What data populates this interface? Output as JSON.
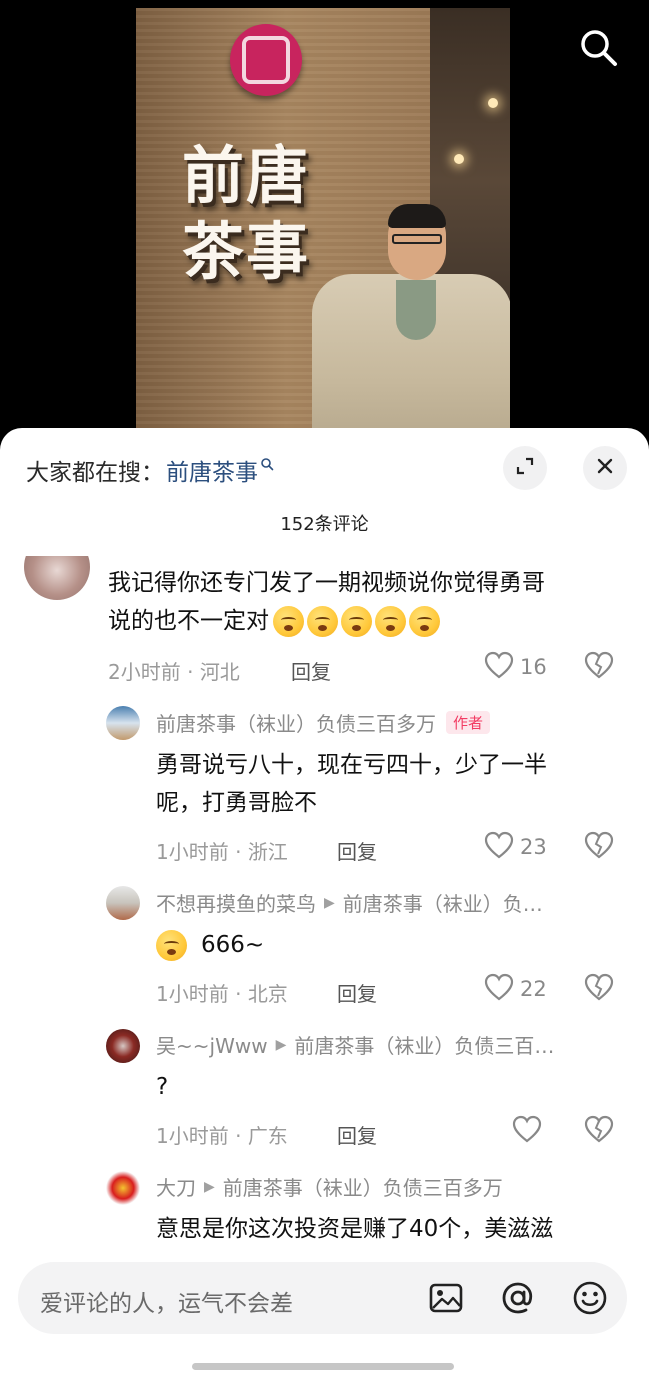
{
  "search_hint": {
    "prefix": "大家都在搜：",
    "keyword": "前唐茶事",
    "icon": "magnifier-small-icon"
  },
  "video": {
    "sign_line1": "前唐",
    "sign_line2": "茶事"
  },
  "comment_count_title": "152条评论",
  "comments": [
    {
      "text_line1": "我记得你还专门发了一期视频说你觉得勇哥",
      "text_line2": "说的也不一定对",
      "emoji_count": 5,
      "time": "2小时前",
      "location": "河北",
      "reply_label": "回复",
      "likes": "16"
    },
    {
      "author": "前唐茶事（袜业）负债三百多万",
      "author_tag": "作者",
      "text_line1": "勇哥说亏八十，现在亏四十，少了一半",
      "text_line2": "呢，打勇哥脸不",
      "time": "1小时前",
      "location": "浙江",
      "reply_label": "回复",
      "likes": "23"
    },
    {
      "author": "不想再摸鱼的菜鸟",
      "reply_to": "前唐茶事（袜业）负…",
      "text": "666~",
      "time": "1小时前",
      "location": "北京",
      "reply_label": "回复",
      "likes": "22"
    },
    {
      "author": "吴~~jWww",
      "reply_to": "前唐茶事（袜业）负债三百…",
      "text": "?",
      "time": "1小时前",
      "location": "广东",
      "reply_label": "回复",
      "likes": ""
    },
    {
      "author": "大刀",
      "reply_to": "前唐茶事（袜业）负债三百多万",
      "text": "意思是你这次投资是赚了40个，美滋滋"
    }
  ],
  "input": {
    "placeholder": "爱评论的人，运气不会差"
  },
  "colors": {
    "keyword": "#2c4f7e",
    "author_tag_bg": "#fde7ec",
    "author_tag_text": "#f23c63"
  }
}
